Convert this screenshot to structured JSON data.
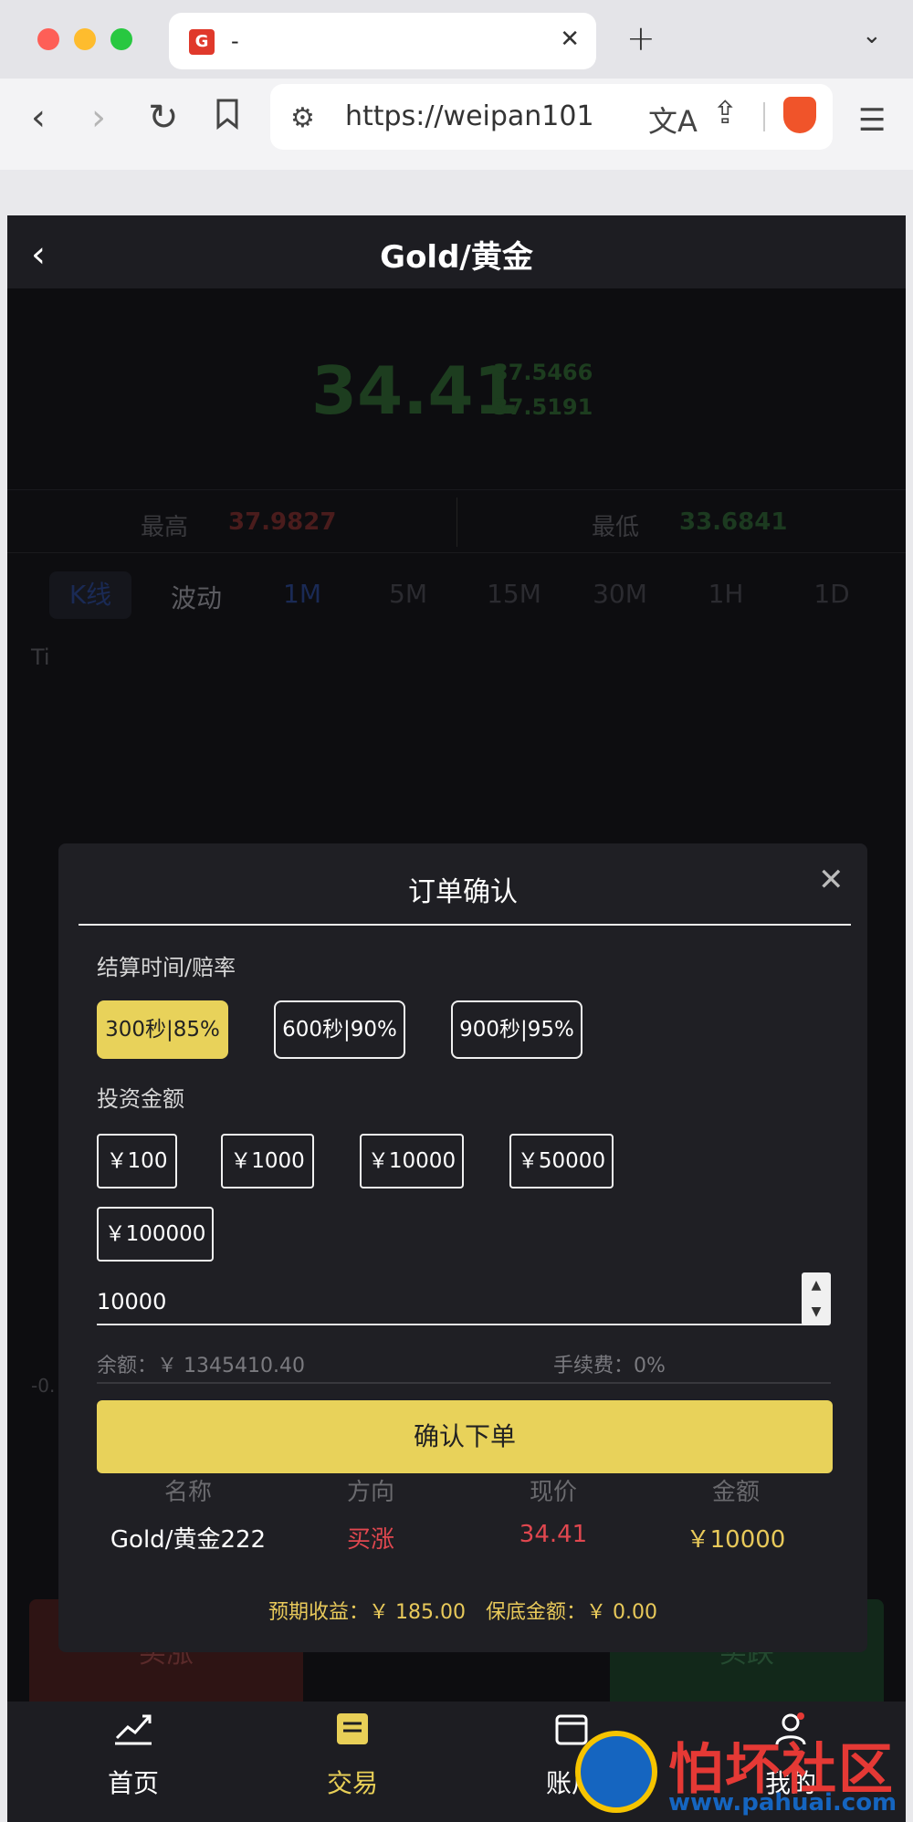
{
  "browser": {
    "tab_title": "-",
    "tab_favicon": "G",
    "close_glyph": "✕",
    "new_tab_glyph": "+",
    "tab_menu_glyph": "⌄",
    "url": "https://weipan101",
    "translate_glyph": "文A"
  },
  "header": {
    "back_glyph": "‹",
    "title": "Gold/黄金"
  },
  "quote": {
    "price": "34.41",
    "sub1": "37.5466",
    "sub2": "37.5191",
    "high_label": "最高",
    "high_value": "37.9827",
    "low_label": "最低",
    "low_value": "33.6841"
  },
  "periods": [
    "K线",
    "波动",
    "1M",
    "5M",
    "15M",
    "30M",
    "1H",
    "1D"
  ],
  "chart": {
    "label_top": "Ti",
    "label_bottom": "-0."
  },
  "actions": {
    "buy_up": "买涨",
    "buy_down": "买跌"
  },
  "bottom_nav": [
    {
      "label": "首页",
      "icon": "chart-icon"
    },
    {
      "label": "交易",
      "icon": "trade-icon"
    },
    {
      "label": "账户",
      "icon": "wallet-icon"
    },
    {
      "label": "我的",
      "icon": "user-icon"
    }
  ],
  "modal": {
    "title": "订单确认",
    "close_glyph": "✕",
    "time_label": "结算时间/赔率",
    "time_options": [
      "300秒|85%",
      "600秒|90%",
      "900秒|95%"
    ],
    "amount_label": "投资金额",
    "amount_options": [
      "￥100",
      "￥1000",
      "￥10000",
      "￥50000",
      "￥100000"
    ],
    "amount_value": "10000",
    "balance": "余额：￥ 1345410.40",
    "fee": "手续费：0%",
    "confirm_label": "确认下单",
    "summary_headers": [
      "名称",
      "方向",
      "现价",
      "金额"
    ],
    "summary_values": [
      "Gold/黄金222",
      "买涨",
      "34.41",
      "￥10000"
    ],
    "expected": "预期收益：￥ 185.00　保底金额：￥ 0.00",
    "colors": {
      "accent": "#e8d25a",
      "up": "#e0474f",
      "gold": "#e8c95a"
    }
  },
  "watermark": {
    "text": "怕坏社区",
    "url": "www.pahuai.com"
  }
}
